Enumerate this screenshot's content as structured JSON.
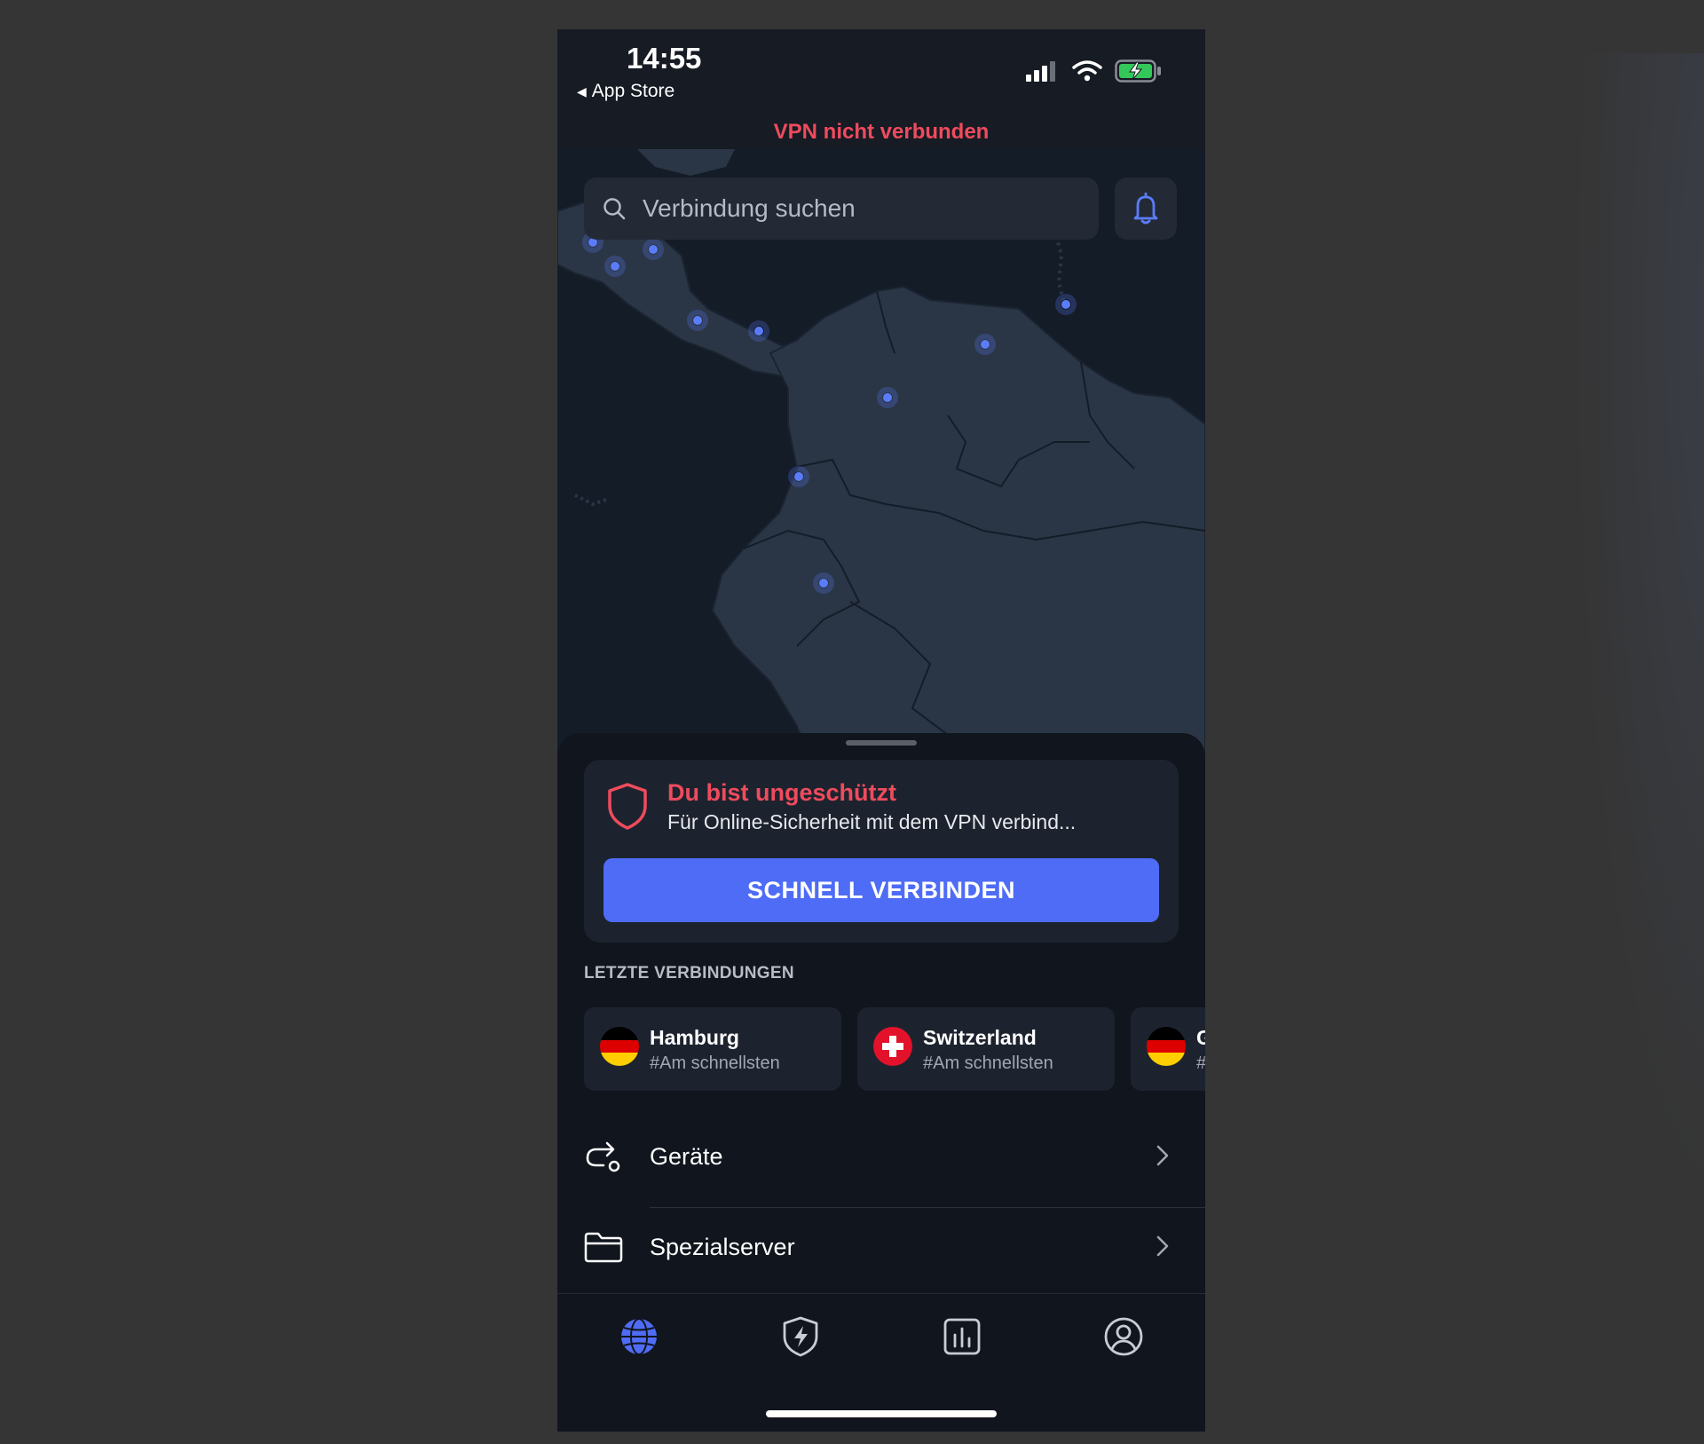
{
  "status_bar": {
    "time": "14:55",
    "back_label": "App Store"
  },
  "vpn_status": {
    "text": "VPN nicht verbunden",
    "color": "#ef4b5d"
  },
  "search": {
    "placeholder": "Verbindung suchen"
  },
  "protection_card": {
    "title": "Du bist ungeschützt",
    "subtitle": "Für Online-Sicherheit mit dem VPN verbind...",
    "button_label": "SCHNELL VERBINDEN"
  },
  "recent": {
    "heading": "LETZTE VERBINDUNGEN",
    "items": [
      {
        "title": "Hamburg",
        "subtitle": "#Am schnellsten",
        "flag": "germany-flag"
      },
      {
        "title": "Switzerland",
        "subtitle": "#Am schnellsten",
        "flag": "switzerland-flag"
      },
      {
        "title": "G",
        "subtitle": "#",
        "flag": "germany-flag"
      }
    ]
  },
  "menu": [
    {
      "label": "Geräte",
      "icon": "devices-icon"
    },
    {
      "label": "Spezialserver",
      "icon": "folder-icon"
    }
  ],
  "tabs": [
    {
      "name": "globe-icon",
      "active": true
    },
    {
      "name": "shield-bolt-icon",
      "active": false
    },
    {
      "name": "stats-icon",
      "active": false
    },
    {
      "name": "profile-icon",
      "active": false
    }
  ],
  "colors": {
    "accent": "#4e6cf6",
    "danger": "#ef4b5d",
    "background": "#161b24",
    "sheet": "#11151d",
    "card": "#1d232e"
  }
}
